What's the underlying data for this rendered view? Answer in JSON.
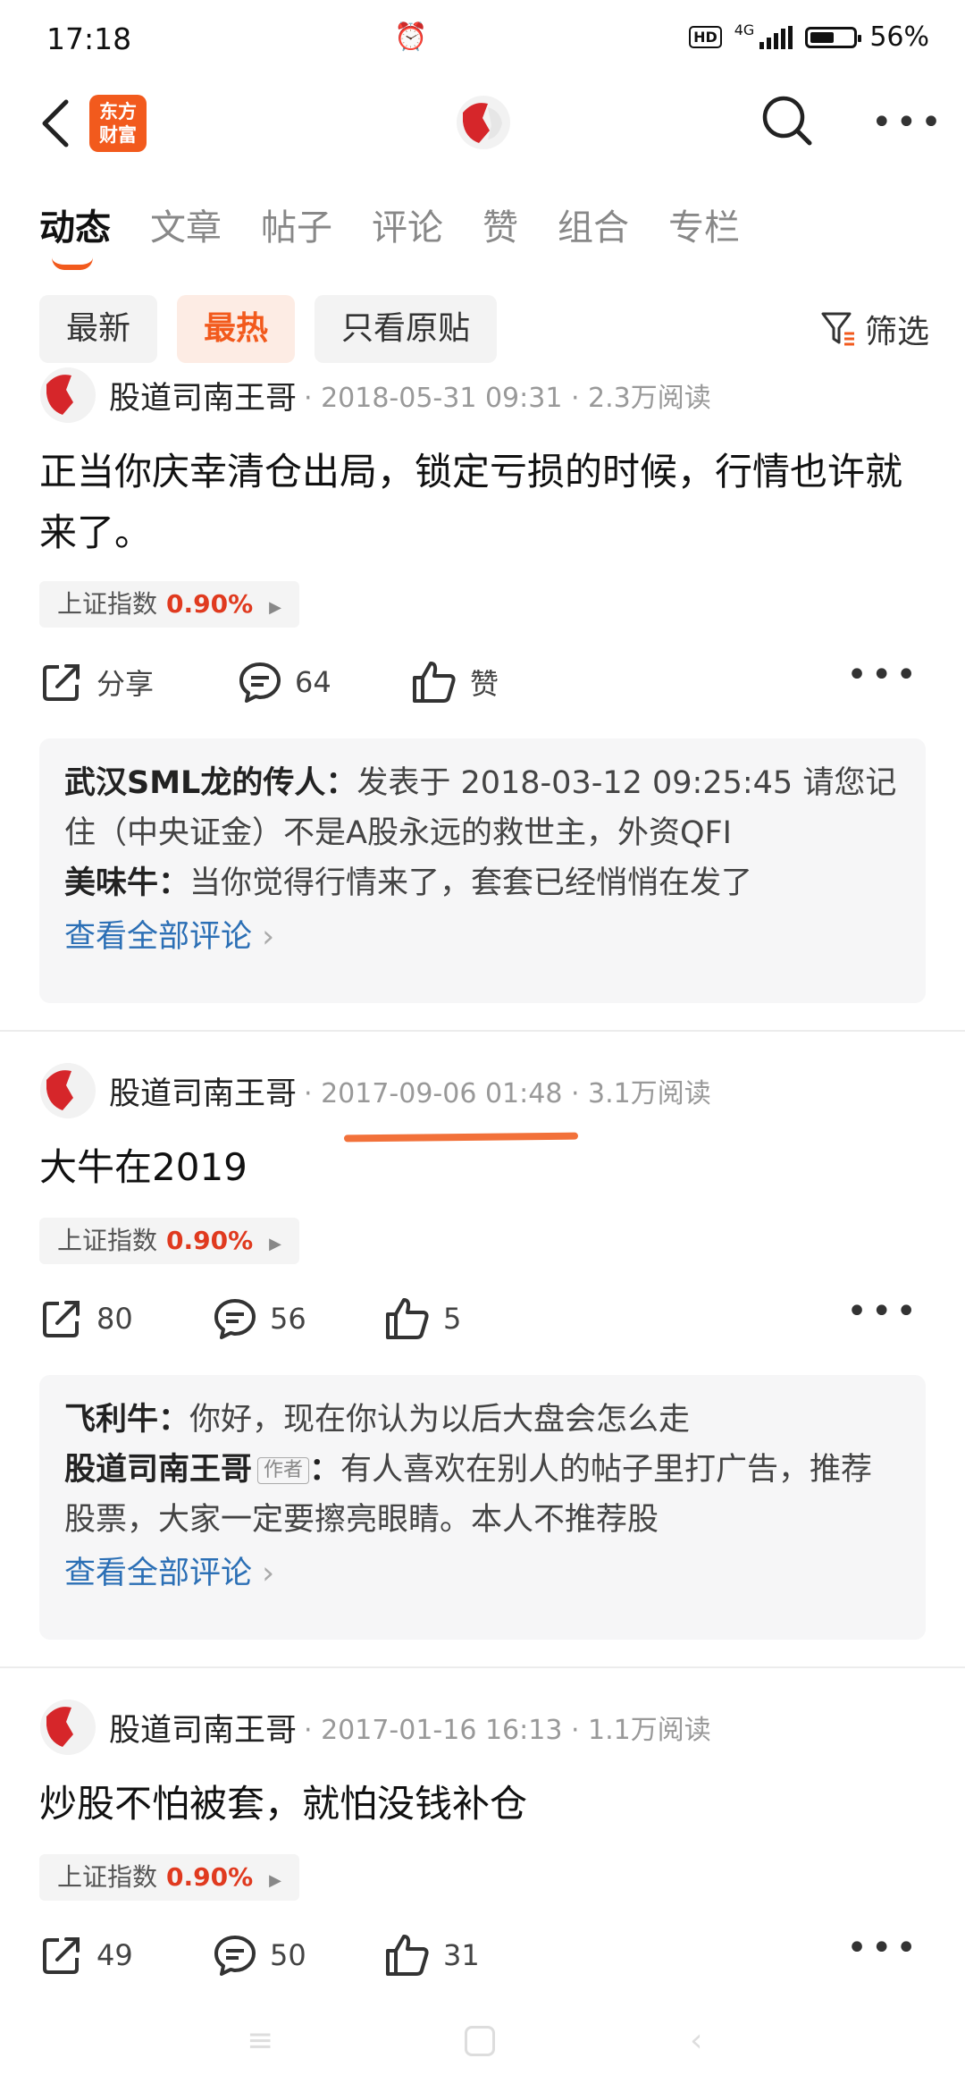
{
  "status_bar": {
    "time": "17:18",
    "network": "4G",
    "hd": "HD",
    "battery": "56%"
  },
  "header": {
    "logo_line1": "东方",
    "logo_line2": "财富"
  },
  "tabs": [
    {
      "label": "动态"
    },
    {
      "label": "文章"
    },
    {
      "label": "帖子"
    },
    {
      "label": "评论"
    },
    {
      "label": "赞"
    },
    {
      "label": "组合"
    },
    {
      "label": "专栏"
    }
  ],
  "filters": {
    "latest": "最新",
    "hot": "最热",
    "original": "只看原贴",
    "filter": "筛选"
  },
  "posts": [
    {
      "author": "股道司南王哥",
      "meta": "· 2018-05-31 09:31 · 2.3万阅读",
      "title": "正当你庆幸清仓出局，锁定亏损的时候，行情也许就来了。",
      "index_label": "上证指数",
      "index_value": "0.90%",
      "share": "分享",
      "comments": "64",
      "likes": "赞",
      "comment_preview": [
        {
          "user": "武汉SML龙的传人：",
          "text": "发表于 2018-03-12 09:25:45  请您记住（中央证金）不是A股永远的救世主，外资QFI"
        },
        {
          "user": "美味牛：",
          "text": "当你觉得行情来了，套套已经悄悄在发了"
        }
      ],
      "view_all": "查看全部评论"
    },
    {
      "author": "股道司南王哥",
      "meta": "· 2017-09-06 01:48 · 3.1万阅读",
      "title": "大牛在2019",
      "index_label": "上证指数",
      "index_value": "0.90%",
      "share": "80",
      "comments": "56",
      "likes": "5",
      "comment_preview": [
        {
          "user": "飞利牛：",
          "text": "你好，现在你认为以后大盘会怎么走"
        },
        {
          "user": "股道司南王哥",
          "tag": "作者",
          "sep": "：",
          "text": "有人喜欢在别人的帖子里打广告，推荐股票，大家一定要擦亮眼睛。本人不推荐股"
        }
      ],
      "view_all": "查看全部评论"
    },
    {
      "author": "股道司南王哥",
      "meta": "· 2017-01-16 16:13 · 1.1万阅读",
      "title": "炒股不怕被套，就怕没钱补仓",
      "index_label": "上证指数",
      "index_value": "0.90%",
      "share": "49",
      "comments": "50",
      "likes": "31"
    }
  ],
  "colors": {
    "accent": "#f25a1d",
    "link": "#2b6fb5",
    "index_up": "#e03a1f"
  }
}
